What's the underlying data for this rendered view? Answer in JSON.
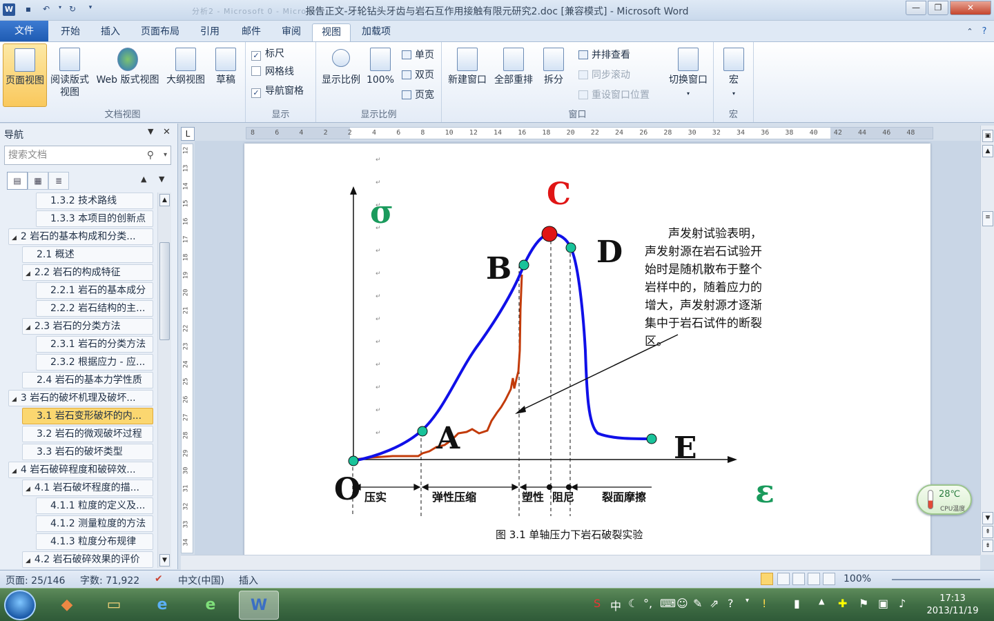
{
  "app": {
    "title": "报告正文-牙轮钻头牙齿与岩石互作用接触有限元研究2.doc [兼容模式] - Microsoft Word",
    "ghost_title": "分析2 - Microsoft 0 - Microsoft"
  },
  "ribbon_tabs": [
    "文件",
    "开始",
    "插入",
    "页面布局",
    "引用",
    "邮件",
    "审阅",
    "视图",
    "加载项"
  ],
  "active_tab": "视图",
  "ribbon": {
    "doc_views": {
      "label": "文档视图",
      "buttons": [
        "页面视图",
        "阅读版式\n视图",
        "Web 版式视图",
        "大纲视图",
        "草稿"
      ]
    },
    "show": {
      "label": "显示",
      "ruler": "标尺",
      "gridlines": "网格线",
      "nav_pane": "导航窗格",
      "ruler_checked": true,
      "gridlines_checked": false,
      "nav_pane_checked": true
    },
    "zoom": {
      "label": "显示比例",
      "zoom_btn": "显示比例",
      "hundred": "100%",
      "one_page": "单页",
      "two_pages": "双页",
      "page_width": "页宽"
    },
    "window": {
      "label": "窗口",
      "new_window": "新建窗口",
      "arrange_all": "全部重排",
      "split": "拆分",
      "side_by_side": "并排查看",
      "sync_scroll": "同步滚动",
      "reset_pos": "重设窗口位置",
      "switch_windows": "切换窗口"
    },
    "macros": {
      "label": "宏",
      "btn": "宏"
    }
  },
  "nav": {
    "title": "导航",
    "search_placeholder": "搜索文档",
    "items": [
      {
        "text": "1.3.2 技术路线",
        "level": 3,
        "exp": false,
        "cur": false
      },
      {
        "text": "1.3.3 本项目的创新点",
        "level": 3,
        "exp": false,
        "cur": false
      },
      {
        "text": "2 岩石的基本构成和分类...",
        "level": 1,
        "exp": true,
        "cur": false
      },
      {
        "text": "2.1 概述",
        "level": 2,
        "exp": false,
        "cur": false
      },
      {
        "text": "2.2 岩石的构成特征",
        "level": 2,
        "exp": true,
        "cur": false
      },
      {
        "text": "2.2.1 岩石的基本成分",
        "level": 3,
        "exp": false,
        "cur": false
      },
      {
        "text": "2.2.2 岩石结构的主...",
        "level": 3,
        "exp": false,
        "cur": false
      },
      {
        "text": "2.3 岩石的分类方法",
        "level": 2,
        "exp": true,
        "cur": false
      },
      {
        "text": "2.3.1 岩石的分类方法",
        "level": 3,
        "exp": false,
        "cur": false
      },
      {
        "text": "2.3.2 根据应力 - 应...",
        "level": 3,
        "exp": false,
        "cur": false
      },
      {
        "text": "2.4 岩石的基本力学性质",
        "level": 2,
        "exp": false,
        "cur": false
      },
      {
        "text": "3 岩石的破坏机理及破坏...",
        "level": 1,
        "exp": true,
        "cur": false
      },
      {
        "text": "3.1 岩石变形破坏的内...",
        "level": 2,
        "exp": false,
        "cur": true
      },
      {
        "text": "3.2 岩石的微观破坏过程",
        "level": 2,
        "exp": false,
        "cur": false
      },
      {
        "text": "3.3 岩石的破坏类型",
        "level": 2,
        "exp": false,
        "cur": false
      },
      {
        "text": "4 岩石破碎程度和破碎效...",
        "level": 1,
        "exp": true,
        "cur": false
      },
      {
        "text": "4.1 岩石破坏程度的描...",
        "level": 2,
        "exp": true,
        "cur": false
      },
      {
        "text": "4.1.1 粒度的定义及...",
        "level": 3,
        "exp": false,
        "cur": false
      },
      {
        "text": "4.1.2 测量粒度的方法",
        "level": 3,
        "exp": false,
        "cur": false
      },
      {
        "text": "4.1.3 粒度分布规律",
        "level": 3,
        "exp": false,
        "cur": false
      },
      {
        "text": "4.2 岩石破碎效果的评价",
        "level": 2,
        "exp": true,
        "cur": false
      }
    ]
  },
  "hruler_ticks": [
    "8",
    "6",
    "4",
    "2",
    "2",
    "4",
    "6",
    "8",
    "10",
    "12",
    "14",
    "16",
    "18",
    "20",
    "22",
    "24",
    "26",
    "28",
    "30",
    "32",
    "34",
    "36",
    "38",
    "40",
    "42",
    "44",
    "46",
    "48"
  ],
  "vruler_ticks": [
    "12",
    "13",
    "14",
    "15",
    "16",
    "17",
    "18",
    "19",
    "20",
    "21",
    "22",
    "23",
    "24",
    "25",
    "26",
    "27",
    "28",
    "29",
    "30",
    "31",
    "32",
    "33",
    "34"
  ],
  "figure": {
    "sigma": "σ",
    "epsilon": "ε",
    "points": {
      "O": "O",
      "A": "A",
      "B": "B",
      "C": "C",
      "D": "D",
      "E": "E"
    },
    "annotation": [
      "　　声发射试验表明，",
      "声发射源在岩石试验开",
      "始时是随机散布于整个",
      "岩样中的，随着应力的",
      "增大，声发射源才逐渐",
      "集中于岩石试件的断裂",
      "区。"
    ],
    "stages": [
      "压实",
      "弹性压缩",
      "塑性",
      "阻尼",
      "裂面摩擦"
    ],
    "caption": "图 3.1  单轴压力下岩石破裂实验",
    "colors": {
      "curve": "#1010e8",
      "ae": "#c23b0a",
      "peak": "#e01515",
      "dots": "#19c39a",
      "c_label": "#e01515",
      "sigma": "#1a9a5c"
    }
  },
  "status": {
    "page": "页面: 25/146",
    "words": "字数: 71,922",
    "lang": "中文(中国)",
    "mode": "插入",
    "zoom": "100%"
  },
  "widget": {
    "temp": "28℃",
    "label": "CPU温度"
  },
  "clock": {
    "time": "17:13",
    "date": "2013/11/19"
  }
}
